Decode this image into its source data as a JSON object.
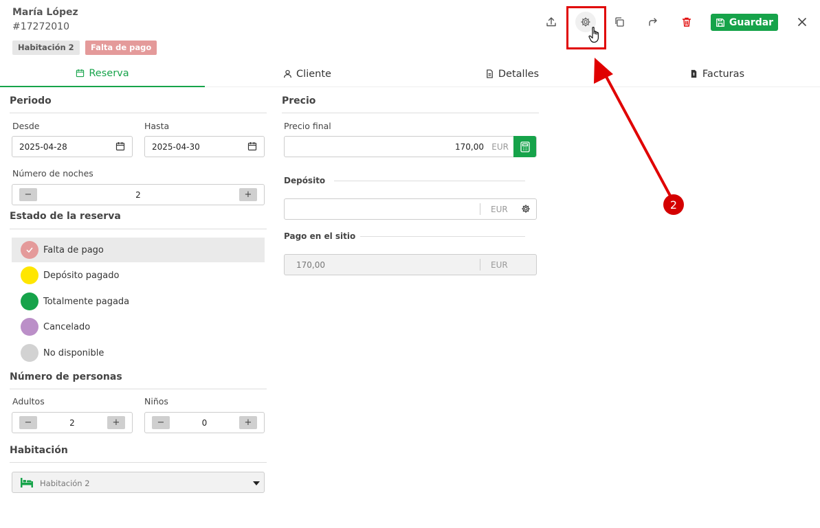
{
  "header": {
    "guest_name": "María López",
    "booking_id": "#17272010",
    "room_badge": "Habitación 2",
    "status_badge": "Falta de pago",
    "save_label": "Guardar"
  },
  "icons": {
    "export": "upload-icon",
    "settings": "gear-icon",
    "duplicate": "copy-icon",
    "forward": "share-icon",
    "delete": "trash-icon",
    "save": "floppy-icon",
    "close": "close-icon"
  },
  "tabs": [
    {
      "label": "Reserva",
      "active": true
    },
    {
      "label": "Cliente"
    },
    {
      "label": "Detalles"
    },
    {
      "label": "Facturas"
    }
  ],
  "periodo": {
    "title": "Periodo",
    "desde_label": "Desde",
    "desde_value": "2025-04-28",
    "hasta_label": "Hasta",
    "hasta_value": "2025-04-30",
    "noches_label": "Número de noches",
    "noches_value": "2"
  },
  "estado": {
    "title": "Estado de la reserva",
    "items": [
      {
        "label": "Falta de pago",
        "color": "#e49a9a",
        "selected": true
      },
      {
        "label": "Depósito pagado",
        "color": "#ffe600"
      },
      {
        "label": "Totalmente pagada",
        "color": "#16a34a"
      },
      {
        "label": "Cancelado",
        "color": "#bb8fc8"
      },
      {
        "label": "No disponible",
        "color": "#d2d2d2"
      }
    ]
  },
  "personas": {
    "title": "Número de personas",
    "adultos_label": "Adultos",
    "adultos_value": "2",
    "ninos_label": "Niños",
    "ninos_value": "0"
  },
  "habitacion": {
    "title": "Habitación",
    "value": "Habitación 2"
  },
  "precio": {
    "title": "Precio",
    "final_label": "Precio final",
    "final_value": "170,00",
    "currency": "EUR",
    "deposito_label": "Depósito",
    "deposito_value": "",
    "pago_label": "Pago en el sitio",
    "pago_value": "170,00"
  },
  "annotation": {
    "step": "2",
    "color": "#e00000"
  },
  "colors": {
    "accent": "#16a34a",
    "danger": "#e00000"
  }
}
